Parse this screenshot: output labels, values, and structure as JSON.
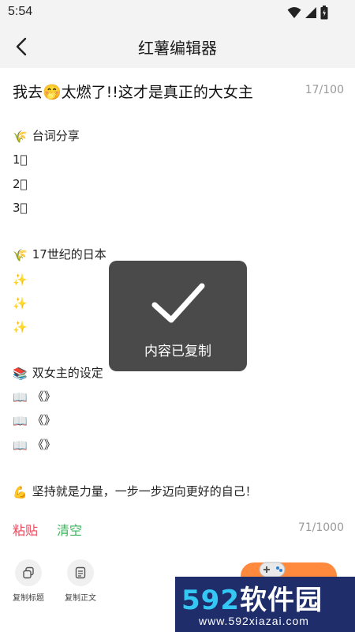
{
  "status_bar": {
    "time": "5:54",
    "icons": [
      "wifi-icon",
      "signal-icon",
      "battery-icon"
    ]
  },
  "app_bar": {
    "title": "红薯编辑器",
    "back_icon": "chevron-left-icon"
  },
  "editor": {
    "title": "我去🤭太燃了!!这才是真正的大女主",
    "title_count": "17/100",
    "lines": [
      {
        "emoji": "🌾",
        "text": "台词分享"
      },
      {
        "emoji": "",
        "text": "1⃣"
      },
      {
        "emoji": "",
        "text": "2⃣"
      },
      {
        "emoji": "",
        "text": "3⃣"
      },
      {
        "emoji": "🌾",
        "text": "17世纪的日本"
      },
      {
        "emoji": "✨",
        "text": ""
      },
      {
        "emoji": "✨",
        "text": ""
      },
      {
        "emoji": "✨",
        "text": ""
      },
      {
        "emoji": "📚",
        "text": "双女主的设定"
      },
      {
        "emoji": "📖",
        "text": "《》"
      },
      {
        "emoji": "📖",
        "text": "《》"
      },
      {
        "emoji": "📖",
        "text": "《》"
      },
      {
        "emoji": "💪",
        "text": "坚持就是力量，一步一步迈向更好的自己！"
      }
    ],
    "body_count": "71/1000"
  },
  "actions": {
    "paste": "粘贴",
    "clear": "清空"
  },
  "bottom_tools": {
    "copy_title": "复制标题",
    "copy_body": "复制正文"
  },
  "toast": {
    "message": "内容已复制",
    "icon": "checkmark-icon"
  },
  "watermark": {
    "main_num": "592",
    "main_text": "软件园",
    "sub": "www.592xiazai.com"
  },
  "colors": {
    "paste": "#e8495d",
    "clear": "#3bb55b",
    "orange": "#ff8a3d",
    "watermark_bg": "#1f2d6b",
    "watermark_accent": "#35c7f3"
  }
}
